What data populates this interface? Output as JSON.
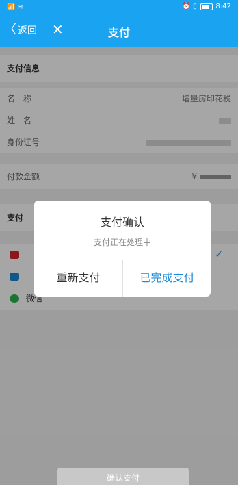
{
  "status_bar": {
    "signal": "📶",
    "wifi": "≋",
    "icons_right": "⏰ ▯",
    "time": "8:42"
  },
  "nav": {
    "back_label": "返回",
    "close_symbol": "✕",
    "title": "支付"
  },
  "payment_info": {
    "header": "支付信息",
    "name_label": "名　称",
    "name_value": "增量房印花税",
    "person_label": "姓　名",
    "id_label": "身份证号",
    "amount_label": "付款金额",
    "currency_symbol": "¥"
  },
  "payment_methods": {
    "header": "支付",
    "wechat_label": "微信"
  },
  "dialog": {
    "title": "支付确认",
    "message": "支付正在处理中",
    "retry_label": "重新支付",
    "done_label": "已完成支付"
  },
  "confirm_label": "确认支付",
  "colors": {
    "brand": "#1aa3f0",
    "link": "#1a88d8",
    "wechat": "#2bb24c"
  }
}
